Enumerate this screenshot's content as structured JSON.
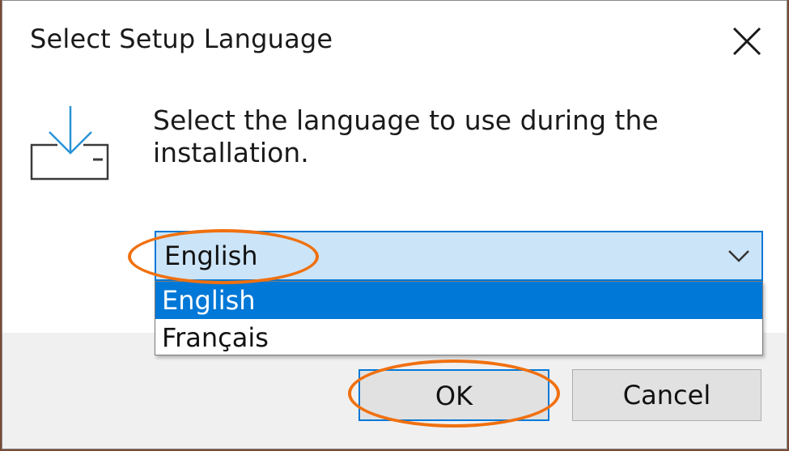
{
  "dialog": {
    "title": "Select Setup Language",
    "prompt": "Select the language to use during the installation.",
    "close_icon": "close-icon",
    "setup_icon": "download-install-icon"
  },
  "language_select": {
    "selected_value": "English",
    "options": [
      "English",
      "Français"
    ],
    "highlighted_option": "English"
  },
  "buttons": {
    "ok_label": "OK",
    "cancel_label": "Cancel"
  },
  "colors": {
    "accent": "#0078d7",
    "annotation": "#f0700f",
    "combo_background": "#cce4f7"
  }
}
